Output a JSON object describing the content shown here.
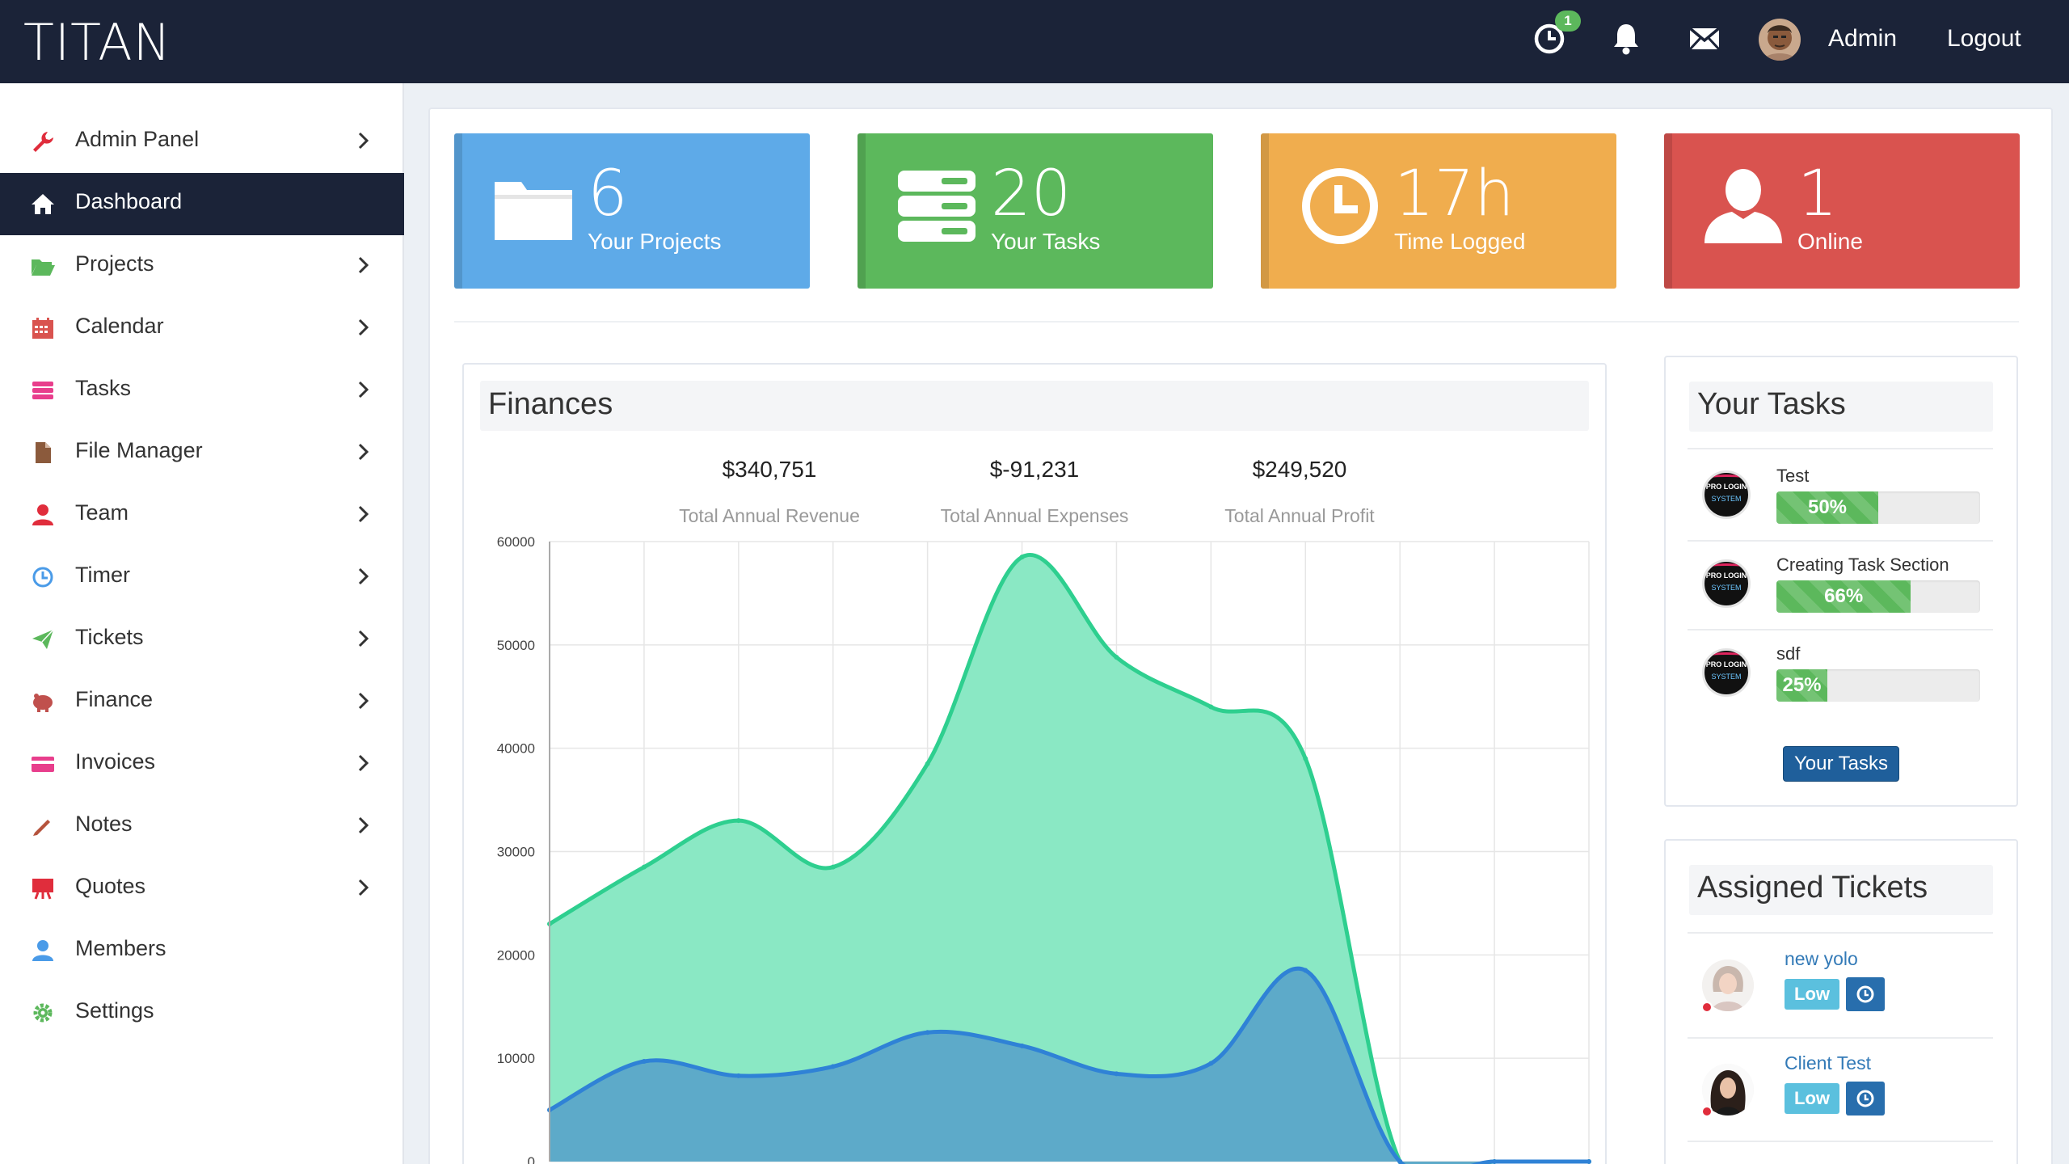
{
  "header": {
    "brand": "TITAN",
    "timer_badge": "1",
    "user_name": "Admin",
    "logout_label": "Logout"
  },
  "sidebar": {
    "items": [
      {
        "label": "Admin Panel",
        "icon": "wrench-icon",
        "color": "#e02d3c",
        "chevron": true,
        "active": false
      },
      {
        "label": "Dashboard",
        "icon": "home-icon",
        "color": "#ffffff",
        "chevron": false,
        "active": true
      },
      {
        "label": "Projects",
        "icon": "folder-open-icon",
        "color": "#5cb85c",
        "chevron": true,
        "active": false
      },
      {
        "label": "Calendar",
        "icon": "calendar-icon",
        "color": "#d9534f",
        "chevron": true,
        "active": false
      },
      {
        "label": "Tasks",
        "icon": "tasks-icon",
        "color": "#e83e8c",
        "chevron": true,
        "active": false
      },
      {
        "label": "File Manager",
        "icon": "file-icon",
        "color": "#8b5a3c",
        "chevron": true,
        "active": false
      },
      {
        "label": "Team",
        "icon": "user-icon",
        "color": "#e02d3c",
        "chevron": true,
        "active": false
      },
      {
        "label": "Timer",
        "icon": "clock-icon",
        "color": "#4a9be8",
        "chevron": true,
        "active": false
      },
      {
        "label": "Tickets",
        "icon": "paper-plane-icon",
        "color": "#5cb85c",
        "chevron": true,
        "active": false
      },
      {
        "label": "Finance",
        "icon": "piggy-bank-icon",
        "color": "#c0504d",
        "chevron": true,
        "active": false
      },
      {
        "label": "Invoices",
        "icon": "credit-card-icon",
        "color": "#e83e8c",
        "chevron": true,
        "active": false
      },
      {
        "label": "Notes",
        "icon": "pencil-icon",
        "color": "#b5533c",
        "chevron": true,
        "active": false
      },
      {
        "label": "Quotes",
        "icon": "easel-icon",
        "color": "#e02d3c",
        "chevron": true,
        "active": false
      },
      {
        "label": "Members",
        "icon": "user-icon",
        "color": "#4a9be8",
        "chevron": false,
        "active": false
      },
      {
        "label": "Settings",
        "icon": "gear-icon",
        "color": "#5cb85c",
        "chevron": false,
        "active": false
      }
    ]
  },
  "stats": [
    {
      "value": "6",
      "label": "Your Projects",
      "color": "#5eaae8",
      "icon": "folder-icon"
    },
    {
      "value": "20",
      "label": "Your Tasks",
      "color": "#5cb85c",
      "icon": "server-icon"
    },
    {
      "value": "17h",
      "label": "Time Logged",
      "color": "#f0ad4e",
      "icon": "clock-icon"
    },
    {
      "value": "1",
      "label": "Online",
      "color": "#d9534f",
      "icon": "user-icon"
    }
  ],
  "finances": {
    "title": "Finances",
    "totals": [
      {
        "value": "$340,751",
        "label": "Total Annual Revenue"
      },
      {
        "value": "$-91,231",
        "label": "Total Annual Expenses"
      },
      {
        "value": "$249,520",
        "label": "Total Annual Profit"
      }
    ]
  },
  "chart_data": {
    "type": "area",
    "title": "",
    "xlabel": "",
    "ylabel": "",
    "x": [
      0,
      1,
      2,
      3,
      4,
      5,
      6,
      7,
      8,
      9,
      10,
      11
    ],
    "ylim": [
      0,
      60000
    ],
    "yticks": [
      0,
      10000,
      20000,
      30000,
      40000,
      50000,
      60000
    ],
    "grid": true,
    "series": [
      {
        "color": "#2ecf8f",
        "fill": "#8ae8c4",
        "values": [
          23000,
          28500,
          33000,
          28500,
          38500,
          58500,
          48800,
          44000,
          39000,
          0,
          0,
          0
        ]
      },
      {
        "color": "#2f82d6",
        "fill": "#5ba7c9",
        "values": [
          5000,
          9700,
          8300,
          9200,
          12500,
          11200,
          8500,
          9500,
          18500,
          0,
          0,
          0
        ]
      }
    ]
  },
  "tasks_box": {
    "title": "Your Tasks",
    "logo_text_1": "PRO LOGIN",
    "logo_text_2": "SYSTEM",
    "items": [
      {
        "name": "Test",
        "percent": 50,
        "percent_label": "50%"
      },
      {
        "name": "Creating Task Section",
        "percent": 66,
        "percent_label": "66%"
      },
      {
        "name": "sdf",
        "percent": 25,
        "percent_label": "25%"
      }
    ],
    "button_label": "Your Tasks"
  },
  "tickets_box": {
    "title": "Assigned Tickets",
    "items": [
      {
        "name": "new yolo",
        "priority": "Low"
      },
      {
        "name": "Client Test",
        "priority": "Low"
      }
    ]
  }
}
